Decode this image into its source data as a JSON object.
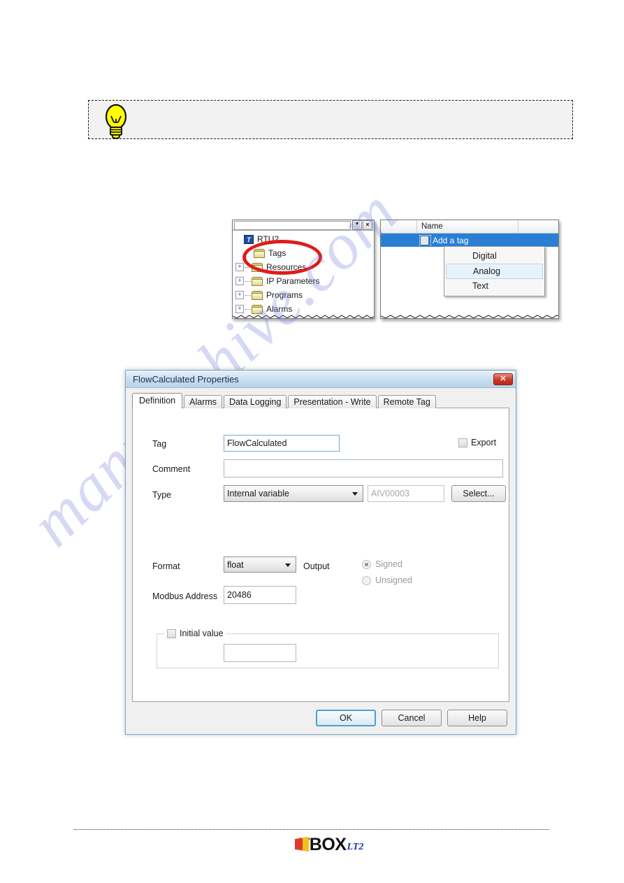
{
  "watermark": {
    "text": "manualshive.com"
  },
  "tip_box": {
    "icon": "lightbulb-icon",
    "text": ""
  },
  "explorer": {
    "tree": {
      "toolbar": {
        "combo_value": "",
        "dropdown_label": "▼",
        "close_label": "×"
      },
      "nodes": [
        {
          "label": "RTU2",
          "icon": "rtu-device-icon",
          "expander": "",
          "level": 0
        },
        {
          "label": "Tags",
          "icon": "folder-icon",
          "expander": "",
          "level": 1
        },
        {
          "label": "Resources",
          "icon": "folder-icon",
          "expander": "+",
          "level": 1
        },
        {
          "label": "IP Parameters",
          "icon": "folder-icon",
          "expander": "+",
          "level": 1
        },
        {
          "label": "Programs",
          "icon": "folder-icon",
          "expander": "+",
          "level": 1
        },
        {
          "label": "Alarms",
          "icon": "folder-icon",
          "expander": "+",
          "level": 1
        }
      ],
      "highlight": {
        "shape": "ellipse",
        "color": "#e01b1b",
        "target": "Tags"
      }
    },
    "list": {
      "columns": [
        "",
        "Name",
        ""
      ],
      "rows": [
        {
          "label": "Add a tag",
          "icon": "new-tag-icon",
          "selected": true
        }
      ]
    },
    "context_menu": {
      "items": [
        {
          "label": "Digital",
          "highlighted": false
        },
        {
          "label": "Analog",
          "highlighted": true
        },
        {
          "label": "Text",
          "highlighted": false
        }
      ]
    }
  },
  "dialog": {
    "title": "FlowCalculated Properties",
    "close_label": "✕",
    "tabs": [
      {
        "label": "Definition",
        "active": true
      },
      {
        "label": "Alarms",
        "active": false
      },
      {
        "label": "Data Logging",
        "active": false
      },
      {
        "label": "Presentation - Write",
        "active": false
      },
      {
        "label": "Remote Tag",
        "active": false
      }
    ],
    "fields": {
      "tag_label": "Tag",
      "tag_value": "FlowCalculated",
      "export_label": "Export",
      "export_checked": false,
      "comment_label": "Comment",
      "comment_value": "",
      "type_label": "Type",
      "type_value": "Internal variable",
      "address_value": "AIV00003",
      "select_label": "Select...",
      "format_label": "Format",
      "format_value": "float",
      "output_label": "Output",
      "signed_label": "Signed",
      "unsigned_label": "Unsigned",
      "output_selected": "Signed",
      "modbus_label": "Modbus Address",
      "modbus_value": "20486",
      "initial_label": "Initial value",
      "initial_checked": false,
      "initial_value": ""
    },
    "buttons": {
      "ok": "OK",
      "cancel": "Cancel",
      "help": "Help"
    }
  },
  "footer": {
    "logo_word": "BOX",
    "logo_letter": "T",
    "logo_sub": "LT2"
  }
}
